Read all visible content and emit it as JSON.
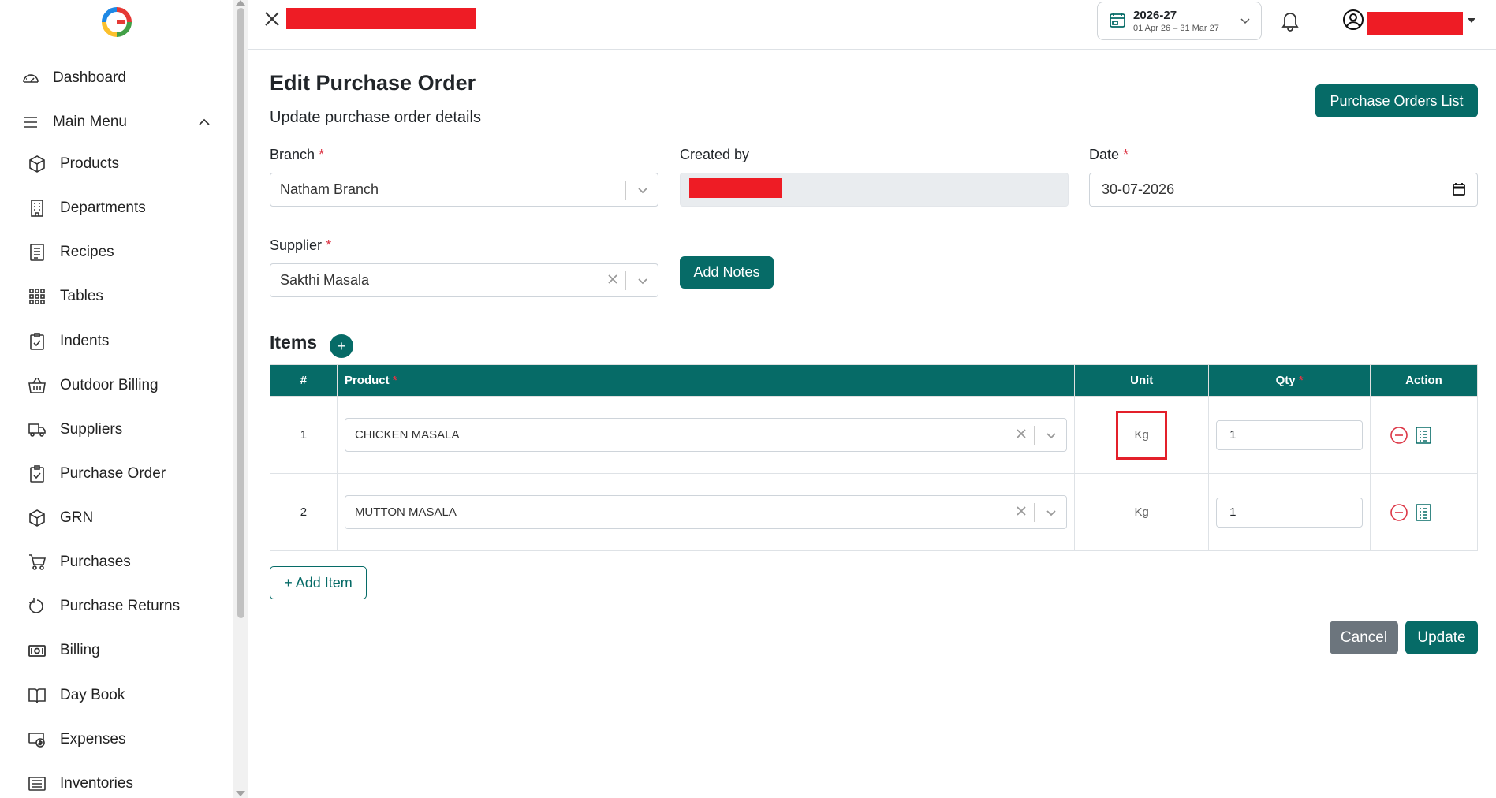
{
  "sidebar": {
    "items": [
      {
        "label": "Dashboard",
        "icon": "dashboard-gauge-icon"
      },
      {
        "label": "Main Menu",
        "icon": "hamburger-menu-icon"
      },
      {
        "label": "Products",
        "icon": "box-icon"
      },
      {
        "label": "Departments",
        "icon": "building-icon"
      },
      {
        "label": "Recipes",
        "icon": "recipe-list-icon"
      },
      {
        "label": "Tables",
        "icon": "grid-dots-icon"
      },
      {
        "label": "Indents",
        "icon": "clipboard-check-icon"
      },
      {
        "label": "Outdoor Billing",
        "icon": "basket-icon"
      },
      {
        "label": "Suppliers",
        "icon": "truck-icon"
      },
      {
        "label": "Purchase Order",
        "icon": "clipboard-check-icon"
      },
      {
        "label": "GRN",
        "icon": "box-icon"
      },
      {
        "label": "Purchases",
        "icon": "cart-icon"
      },
      {
        "label": "Purchase Returns",
        "icon": "return-arrow-icon"
      },
      {
        "label": "Billing",
        "icon": "cash-icon"
      },
      {
        "label": "Day Book",
        "icon": "book-icon"
      },
      {
        "label": "Expenses",
        "icon": "money-icon"
      },
      {
        "label": "Inventories",
        "icon": "inventory-list-icon"
      }
    ]
  },
  "topbar": {
    "fiscal_year": "2026-27",
    "fiscal_range": "01 Apr 26 – 31 Mar 27"
  },
  "page": {
    "title": "Edit Purchase Order",
    "subtitle": "Update purchase order details",
    "list_button": "Purchase Orders List"
  },
  "form": {
    "branch_label": "Branch",
    "branch_value": "Natham Branch",
    "created_by_label": "Created by",
    "date_label": "Date",
    "date_value": "30-07-2026",
    "supplier_label": "Supplier",
    "supplier_value": "Sakthi Masala",
    "notes_button": "Add Notes",
    "required_mark": "*"
  },
  "items": {
    "heading": "Items",
    "plus": "+",
    "columns": {
      "num": "#",
      "product": "Product",
      "unit": "Unit",
      "qty": "Qty",
      "action": "Action"
    },
    "rows": [
      {
        "num": "1",
        "product": "CHICKEN MASALA",
        "unit": "Kg",
        "qty": "1"
      },
      {
        "num": "2",
        "product": "MUTTON MASALA",
        "unit": "Kg",
        "qty": "1"
      }
    ],
    "add_button": "+ Add Item"
  },
  "footer": {
    "cancel": "Cancel",
    "update": "Update"
  },
  "colors": {
    "accent": "#066b67",
    "redaction": "#ee1c25",
    "highlight_border": "#e3202a",
    "cancel_bg": "#6c757d",
    "required": "#dc3545"
  }
}
